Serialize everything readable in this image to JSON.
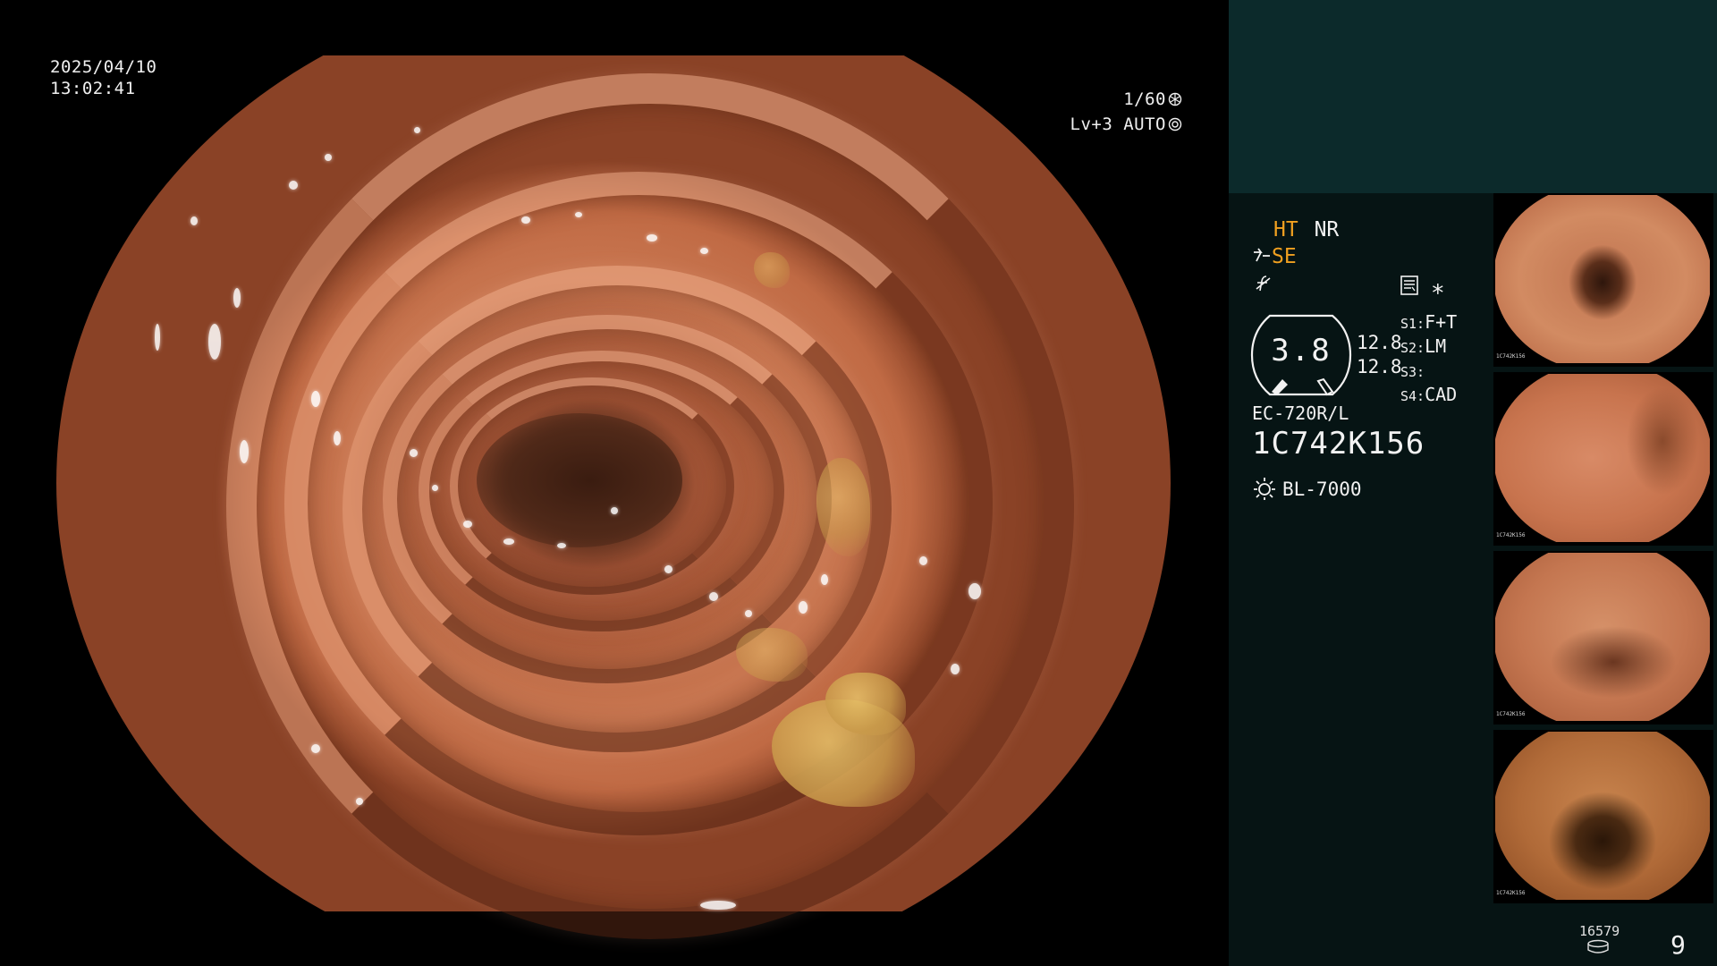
{
  "viewport": {
    "date": "2025/04/10",
    "time": "13:02:41",
    "shutter": "1/60",
    "iris": "Lv+3 AUTO"
  },
  "panel": {
    "ht_label": "HT",
    "nr_label": "NR",
    "se_label": "SE",
    "zoom_value": "3.8",
    "side_value_1": "12.8",
    "side_value_2": "12.8",
    "s1_key": "S1:",
    "s1_value": "F+T",
    "s2_key": "S2:",
    "s2_value": "LM",
    "s3_key": "S3:",
    "s3_value": "",
    "s4_key": "S4:",
    "s4_value": "CAD",
    "scope_model": "EC-720R/L",
    "scope_serial": "1C742K156",
    "light_source": "BL-7000",
    "counter": "16579",
    "capture_count": "9"
  },
  "thumbnails": [
    {
      "label": "1C742K156"
    },
    {
      "label": "1C742K156"
    },
    {
      "label": "1C742K156"
    },
    {
      "label": "1C742K156"
    }
  ],
  "colors": {
    "panel_bg": "#061414",
    "panel_top_bg": "#0c2a2b",
    "accent_orange": "#f0a020",
    "text": "#f2f2f2"
  }
}
